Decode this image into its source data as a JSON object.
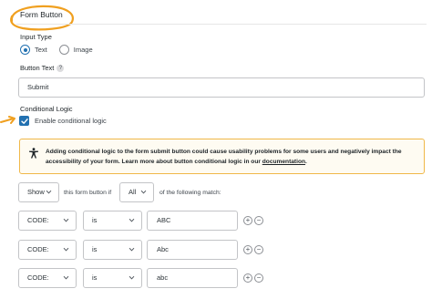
{
  "panel": {
    "title": "Form Button"
  },
  "input_type": {
    "label": "Input Type",
    "options": [
      {
        "label": "Text",
        "checked": true
      },
      {
        "label": "Image",
        "checked": false
      }
    ]
  },
  "button_text": {
    "label": "Button Text",
    "help": "?",
    "value": "Submit"
  },
  "conditional_logic": {
    "label": "Conditional Logic",
    "enable_label": "Enable conditional logic",
    "enabled": true
  },
  "notice": {
    "text": "Adding conditional logic to the form submit button could cause usability problems for some users and negatively impact the accessibility of your form. Learn more about button conditional logic in our ",
    "link": "documentation",
    "end": "."
  },
  "logic_header": {
    "action": "Show",
    "middle_text": "this form button if",
    "match": "All",
    "suffix_text": "of the following match:"
  },
  "rules": [
    {
      "field": "CODE:",
      "operator": "is",
      "value": "ABC"
    },
    {
      "field": "CODE:",
      "operator": "is",
      "value": "Abc"
    },
    {
      "field": "CODE:",
      "operator": "is",
      "value": "abc"
    }
  ],
  "buttons": {
    "add": "+",
    "remove": "−"
  },
  "colors": {
    "accent": "#2271b1",
    "annotation": "#f0a020",
    "notice_border": "#f0b849"
  }
}
